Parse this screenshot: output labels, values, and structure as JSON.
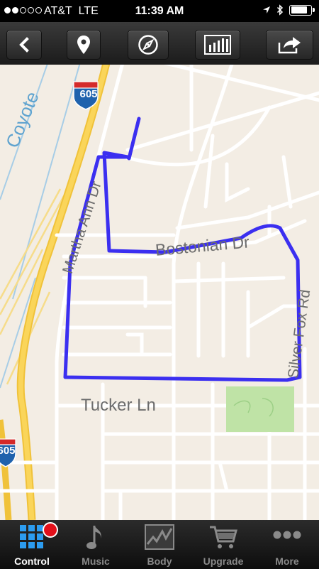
{
  "status_bar": {
    "carrier": "AT&T",
    "network": "LTE",
    "time": "11:39 AM",
    "signal_bars_filled": 2,
    "signal_bars_total": 5,
    "battery_level": 0.8,
    "icons": [
      "location-arrow-icon",
      "bluetooth-icon",
      "battery-icon"
    ]
  },
  "toolbar": {
    "buttons": [
      "back-chevron-icon",
      "map-pin-icon",
      "compass-icon",
      "bar-chart-icon",
      "share-icon"
    ]
  },
  "map": {
    "labels": {
      "coyote": "Coyote",
      "highway_605_top": "605",
      "highway_605_bottom": "605",
      "martha_ann": "Martha Ann Dr",
      "bostonian": "Bostonian Dr",
      "silver_fox": "Silver Fox Rd",
      "tucker": "Tucker Ln"
    },
    "route_color": "#3b2ff0",
    "park_color": "#bfe3a6"
  },
  "tabs": [
    {
      "label": "Control",
      "icon": "grid-icon",
      "active": true
    },
    {
      "label": "Music",
      "icon": "music-note-icon",
      "active": false
    },
    {
      "label": "Body",
      "icon": "activity-graph-icon",
      "active": false
    },
    {
      "label": "Upgrade",
      "icon": "shopping-cart-icon",
      "active": false
    },
    {
      "label": "More",
      "icon": "more-dots-icon",
      "active": false
    }
  ]
}
